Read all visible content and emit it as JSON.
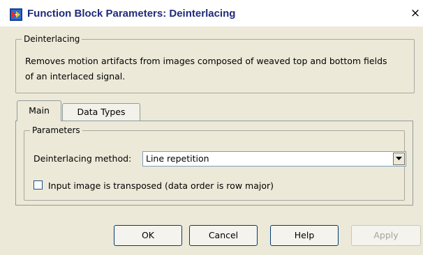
{
  "window": {
    "title": "Function Block Parameters: Deinterlacing",
    "close_glyph": "×",
    "icon": "simulink-block-icon"
  },
  "description_group": {
    "title": "Deinterlacing",
    "text_line1": "Removes motion artifacts from images composed of weaved top and bottom fields",
    "text_line2": "of an interlaced signal."
  },
  "tabs": [
    {
      "label": "Main",
      "active": true
    },
    {
      "label": "Data Types",
      "active": false
    }
  ],
  "parameters_group": {
    "title": "Parameters",
    "method_label": "Deinterlacing method:",
    "method_value": "Line repetition",
    "transpose_label": "Input image is transposed (data order is row major)",
    "transpose_checked": false
  },
  "buttons": {
    "ok": "OK",
    "cancel": "Cancel",
    "help": "Help",
    "apply": "Apply"
  },
  "colors": {
    "title_text": "#1f2b7a",
    "dialog_bg": "#ece9d8",
    "select_border": "#7f9db9"
  }
}
